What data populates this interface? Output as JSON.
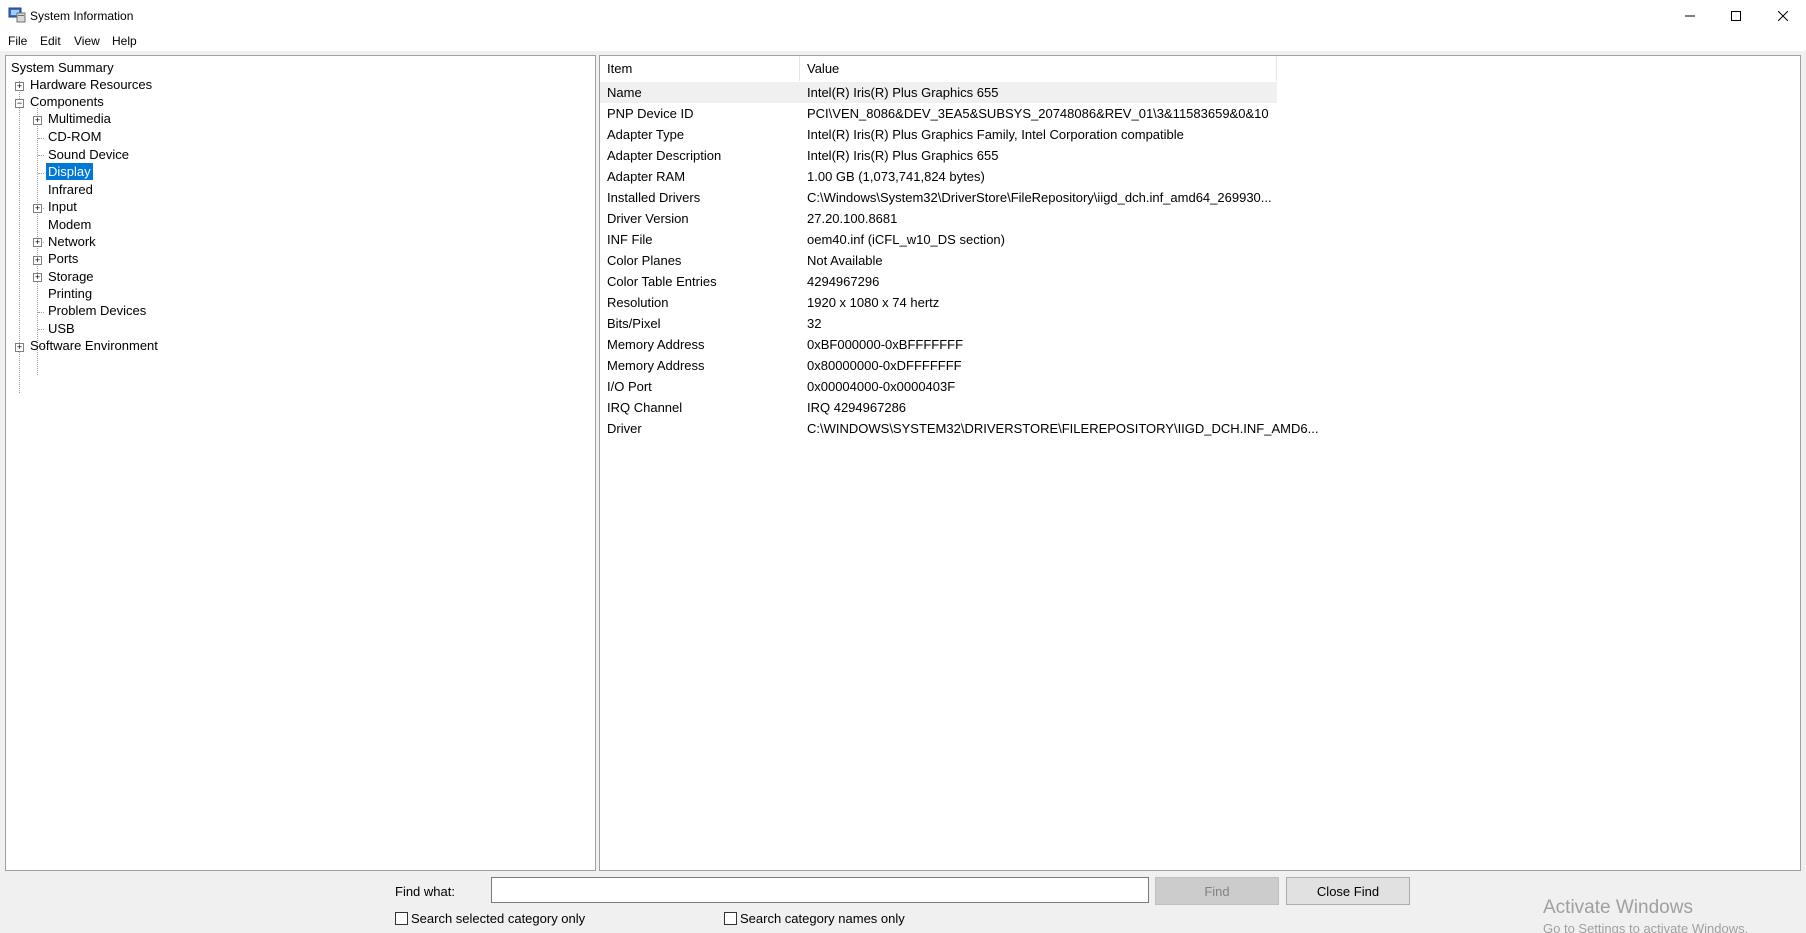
{
  "window": {
    "title": "System Information",
    "controls": {
      "minimize": "—",
      "maximize": "☐",
      "close": "✕"
    }
  },
  "menu": [
    "File",
    "Edit",
    "View",
    "Help"
  ],
  "tree": {
    "root": "System Summary",
    "hardware_resources": "Hardware Resources",
    "components": "Components",
    "component_children": [
      "Multimedia",
      "CD-ROM",
      "Sound Device",
      "Display",
      "Infrared",
      "Input",
      "Modem",
      "Network",
      "Ports",
      "Storage",
      "Printing",
      "Problem Devices",
      "USB"
    ],
    "software_environment": "Software Environment",
    "selected": "Display"
  },
  "details": {
    "headers": {
      "item": "Item",
      "value": "Value"
    },
    "rows": [
      {
        "item": "Name",
        "value": "Intel(R) Iris(R) Plus Graphics 655"
      },
      {
        "item": "PNP Device ID",
        "value": "PCI\\VEN_8086&DEV_3EA5&SUBSYS_20748086&REV_01\\3&11583659&0&10"
      },
      {
        "item": "Adapter Type",
        "value": "Intel(R) Iris(R) Plus Graphics Family, Intel Corporation compatible"
      },
      {
        "item": "Adapter Description",
        "value": "Intel(R) Iris(R) Plus Graphics 655"
      },
      {
        "item": "Adapter RAM",
        "value": "1.00 GB (1,073,741,824 bytes)"
      },
      {
        "item": "Installed Drivers",
        "value": "C:\\Windows\\System32\\DriverStore\\FileRepository\\iigd_dch.inf_amd64_269930..."
      },
      {
        "item": "Driver Version",
        "value": "27.20.100.8681"
      },
      {
        "item": "INF File",
        "value": "oem40.inf (iCFL_w10_DS section)"
      },
      {
        "item": "Color Planes",
        "value": "Not Available"
      },
      {
        "item": "Color Table Entries",
        "value": "4294967296"
      },
      {
        "item": "Resolution",
        "value": "1920 x 1080 x 74 hertz"
      },
      {
        "item": "Bits/Pixel",
        "value": "32"
      },
      {
        "item": "Memory Address",
        "value": "0xBF000000-0xBFFFFFFF"
      },
      {
        "item": "Memory Address",
        "value": "0x80000000-0xDFFFFFFF"
      },
      {
        "item": "I/O Port",
        "value": "0x00004000-0x0000403F"
      },
      {
        "item": "IRQ Channel",
        "value": "IRQ 4294967286"
      },
      {
        "item": "Driver",
        "value": "C:\\WINDOWS\\SYSTEM32\\DRIVERSTORE\\FILEREPOSITORY\\IIGD_DCH.INF_AMD6..."
      }
    ]
  },
  "find": {
    "label": "Find what:",
    "value": "",
    "find_button": "Find",
    "close_button": "Close Find",
    "search_selected": "Search selected category only",
    "search_names": "Search category names only"
  },
  "watermark": {
    "line1": "Activate Windows",
    "line2": "Go to Settings to activate Windows."
  },
  "colors": {
    "selection": "#0078d7",
    "first_row_bg": "#f0f0f0"
  }
}
